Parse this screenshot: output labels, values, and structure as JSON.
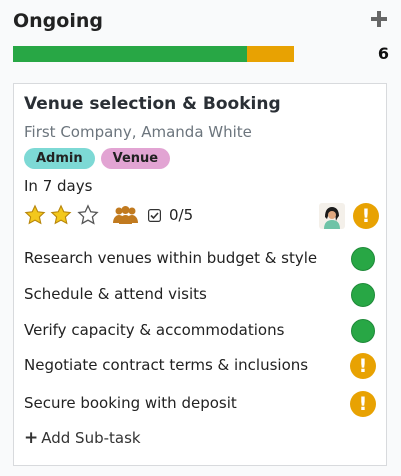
{
  "column": {
    "title": "Ongoing",
    "count": "6",
    "progress": [
      {
        "status": "done",
        "fraction": 0.833,
        "color": "#28a745"
      },
      {
        "status": "at-risk",
        "fraction": 0.167,
        "color": "#e8a202"
      }
    ]
  },
  "card": {
    "title": "Venue selection & Booking",
    "subtitle": "First Company, Amanda White",
    "tags": [
      {
        "label": "Admin",
        "color": "#7dd9d5"
      },
      {
        "label": "Venue",
        "color": "#e2a4d3"
      }
    ],
    "deadline": "In 7 days",
    "priority_stars": {
      "filled": 2,
      "total": 3
    },
    "subtask_count": "0/5",
    "status_color": "#e8a202",
    "subtasks": [
      {
        "label": "Research venues within budget & style",
        "state": "done"
      },
      {
        "label": "Schedule & attend visits",
        "state": "done"
      },
      {
        "label": "Verify capacity & accommodations",
        "state": "done"
      },
      {
        "label": "Negotiate contract terms & inclusions",
        "state": "at-risk"
      },
      {
        "label": "Secure booking with deposit",
        "state": "at-risk"
      }
    ],
    "add_subtask_label": "Add Sub-task"
  },
  "icons": {
    "add_column_item": "plus-icon",
    "people": "people-icon",
    "checklist": "checkbox-icon",
    "avatar": "user-avatar",
    "warning": "exclamation-icon",
    "done": "green-circle-icon"
  }
}
